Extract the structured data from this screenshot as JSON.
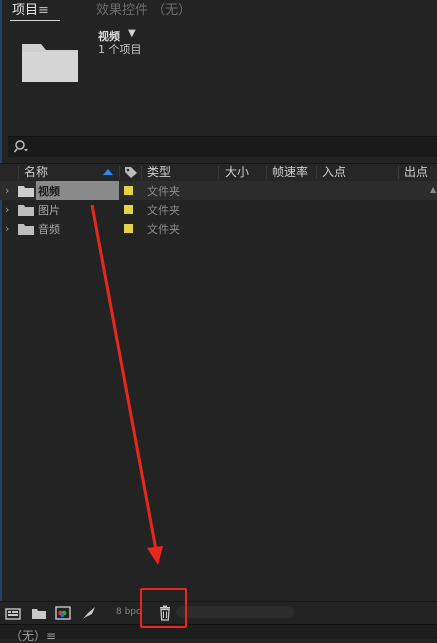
{
  "tabs": {
    "project_label": "项目",
    "project_menu_icon": "≡",
    "effects_label": "效果控件 （无）"
  },
  "preview": {
    "selected_name": "视频",
    "count_text": "1 个项目"
  },
  "search": {
    "icon": "search-icon",
    "value": ""
  },
  "columns": {
    "name": "名称",
    "type": "类型",
    "size": "大小",
    "framerate": "帧速率",
    "in_point": "入点",
    "out_point": "出点"
  },
  "rows": [
    {
      "name": "视频",
      "type": "文件夹",
      "selected": true
    },
    {
      "name": "图片",
      "type": "文件夹",
      "selected": false
    },
    {
      "name": "音频",
      "type": "文件夹",
      "selected": false
    }
  ],
  "toolbar": {
    "bpc_label": "8 bpc"
  },
  "footer": {
    "label": "（无）≡"
  },
  "colors": {
    "panel_bg": "#232323",
    "label_yellow": "#e5d24a",
    "sort_blue": "#2d8ceb",
    "annotation_red": "#e8281d"
  }
}
